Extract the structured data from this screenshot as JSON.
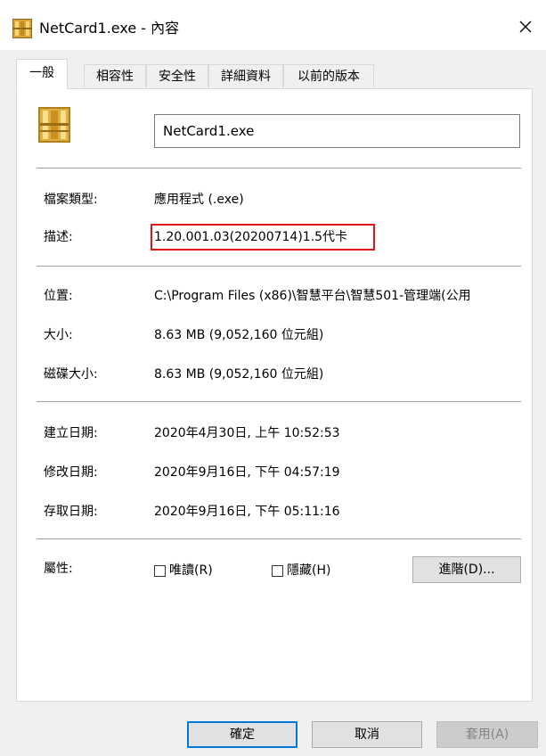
{
  "window": {
    "title": "NetCard1.exe - 內容"
  },
  "tabs": [
    {
      "label": "一般",
      "active": true
    },
    {
      "label": "相容性"
    },
    {
      "label": "安全性"
    },
    {
      "label": "詳細資料"
    },
    {
      "label": "以前的版本"
    }
  ],
  "general": {
    "file_name": "NetCard1.exe",
    "file_type_label": "檔案類型:",
    "file_type_value": "應用程式 (.exe)",
    "description_label": "描述:",
    "description_value": "1.20.001.03(20200714)1.5代卡",
    "location_label": "位置:",
    "location_value": "C:\\Program Files (x86)\\智慧平台\\智慧501-管理端(公用",
    "size_label": "大小:",
    "size_value": "8.63 MB (9,052,160 位元組)",
    "disk_size_label": "磁碟大小:",
    "disk_size_value": "8.63 MB (9,052,160 位元組)",
    "created_label": "建立日期:",
    "created_value": "2020年4月30日, 上午 10:52:53",
    "modified_label": "修改日期:",
    "modified_value": "2020年9月16日, 下午 04:57:19",
    "accessed_label": "存取日期:",
    "accessed_value": "2020年9月16日, 下午 05:11:16",
    "attributes_label": "屬性:",
    "readonly_label": "唯讀(R)",
    "hidden_label": "隱藏(H)",
    "advanced_button": "進階(D)..."
  },
  "footer": {
    "ok": "確定",
    "cancel": "取消",
    "apply": "套用(A)"
  },
  "colors": {
    "highlight": "#e0151b",
    "accent": "#0078d7"
  }
}
